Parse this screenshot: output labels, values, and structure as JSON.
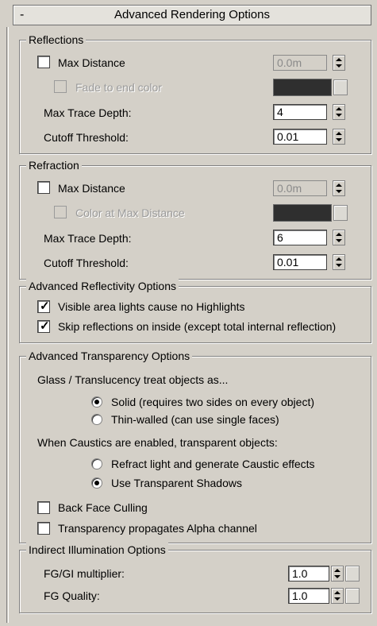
{
  "rollout": {
    "title": "Advanced Rendering Options",
    "collapse_glyph": "-"
  },
  "reflections": {
    "label": "Reflections",
    "max_distance": {
      "label": "Max Distance",
      "checked": false,
      "value": "0.0m"
    },
    "fade_to_end_color": {
      "label": "Fade to end color",
      "checked": false,
      "color": "#2f2f2f"
    },
    "max_trace_depth": {
      "label": "Max Trace Depth:",
      "value": "4"
    },
    "cutoff_threshold": {
      "label": "Cutoff Threshold:",
      "value": "0.01"
    }
  },
  "refraction": {
    "label": "Refraction",
    "max_distance": {
      "label": "Max Distance",
      "checked": false,
      "value": "0.0m"
    },
    "color_at_max_distance": {
      "label": "Color at Max Distance",
      "checked": false,
      "color": "#2f2f2f"
    },
    "max_trace_depth": {
      "label": "Max Trace Depth:",
      "value": "6"
    },
    "cutoff_threshold": {
      "label": "Cutoff Threshold:",
      "value": "0.01"
    }
  },
  "reflectivity": {
    "label": "Advanced Reflectivity Options",
    "visible_area_lights": {
      "label": "Visible area lights cause no Highlights",
      "checked": true
    },
    "skip_reflections": {
      "label": "Skip reflections on inside (except total internal reflection)",
      "checked": true
    }
  },
  "transparency": {
    "label": "Advanced Transparency Options",
    "glass_label": "Glass / Translucency treat objects as...",
    "solid": {
      "label": "Solid (requires two sides on every object)",
      "selected": true
    },
    "thin_walled": {
      "label": "Thin-walled (can use single faces)",
      "selected": false
    },
    "caustics_label": "When Caustics are enabled, transparent objects:",
    "refract_light": {
      "label": "Refract light and generate Caustic effects",
      "selected": false
    },
    "transparent_shadows": {
      "label": "Use Transparent Shadows",
      "selected": true
    },
    "back_face_culling": {
      "label": "Back Face Culling",
      "checked": false
    },
    "propagates_alpha": {
      "label": "Transparency propagates Alpha channel",
      "checked": false
    }
  },
  "indirect": {
    "label": "Indirect Illumination Options",
    "fg_gi_multiplier": {
      "label": "FG/GI multiplier:",
      "value": "1.0"
    },
    "fg_quality": {
      "label": "FG Quality:",
      "value": "1.0"
    }
  }
}
